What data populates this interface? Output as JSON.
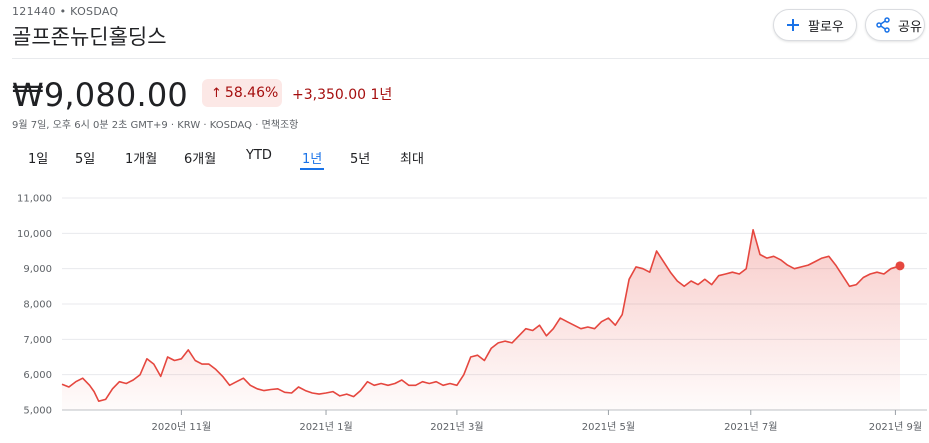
{
  "header": {
    "ticker": "121440 • KOSDAQ",
    "company": "골프존뉴딘홀딩스",
    "follow_label": "팔로우",
    "share_label": "공유"
  },
  "quote": {
    "price": "₩9,080.00",
    "pct_change": "58.46%",
    "abs_change": "+3,350.00 1년",
    "meta": "9월 7일, 오후 6시 0분 2초 GMT+9 · KRW · KOSDAQ · 면책조항"
  },
  "tabs": [
    {
      "label": "1일",
      "active": false
    },
    {
      "label": "5일",
      "active": false
    },
    {
      "label": "1개월",
      "active": false
    },
    {
      "label": "6개월",
      "active": false
    },
    {
      "label": "YTD",
      "active": false
    },
    {
      "label": "1년",
      "active": true
    },
    {
      "label": "5년",
      "active": false
    },
    {
      "label": "최대",
      "active": false
    }
  ],
  "colors": {
    "accent_blue": "#1a73e8",
    "line_red": "#e5473f",
    "loss_gain_red": "#a50e0e",
    "badge_bg": "#fce8e6"
  },
  "chart_data": {
    "type": "area",
    "ylim": [
      5000,
      11000
    ],
    "xlim": [
      0,
      365
    ],
    "y_ticks": [
      {
        "value": 5000,
        "label": "5,000"
      },
      {
        "value": 6000,
        "label": "6,000"
      },
      {
        "value": 7000,
        "label": "7,000"
      },
      {
        "value": 8000,
        "label": "8,000"
      },
      {
        "value": 9000,
        "label": "9,000"
      },
      {
        "value": 10000,
        "label": "10,000"
      },
      {
        "value": 11000,
        "label": "11,000"
      }
    ],
    "x_ticks": [
      {
        "x": 52,
        "label": "2020년 11월"
      },
      {
        "x": 115,
        "label": "2021년 1월"
      },
      {
        "x": 172,
        "label": "2021년 3월"
      },
      {
        "x": 238,
        "label": "2021년 5월"
      },
      {
        "x": 300,
        "label": "2021년 7월"
      },
      {
        "x": 363,
        "label": "2021년 9월"
      }
    ],
    "grid": true,
    "series": [
      {
        "points": [
          [
            0,
            5730
          ],
          [
            3,
            5650
          ],
          [
            6,
            5800
          ],
          [
            9,
            5900
          ],
          [
            12,
            5700
          ],
          [
            14,
            5520
          ],
          [
            16,
            5250
          ],
          [
            19,
            5300
          ],
          [
            22,
            5600
          ],
          [
            25,
            5800
          ],
          [
            28,
            5750
          ],
          [
            31,
            5850
          ],
          [
            34,
            6000
          ],
          [
            37,
            6450
          ],
          [
            40,
            6300
          ],
          [
            43,
            5950
          ],
          [
            46,
            6500
          ],
          [
            49,
            6400
          ],
          [
            52,
            6450
          ],
          [
            55,
            6700
          ],
          [
            58,
            6400
          ],
          [
            61,
            6300
          ],
          [
            64,
            6300
          ],
          [
            67,
            6150
          ],
          [
            70,
            5950
          ],
          [
            73,
            5700
          ],
          [
            76,
            5800
          ],
          [
            79,
            5900
          ],
          [
            82,
            5700
          ],
          [
            85,
            5600
          ],
          [
            88,
            5550
          ],
          [
            91,
            5580
          ],
          [
            94,
            5600
          ],
          [
            97,
            5500
          ],
          [
            100,
            5480
          ],
          [
            103,
            5650
          ],
          [
            106,
            5550
          ],
          [
            109,
            5480
          ],
          [
            112,
            5450
          ],
          [
            115,
            5480
          ],
          [
            118,
            5520
          ],
          [
            121,
            5400
          ],
          [
            124,
            5450
          ],
          [
            127,
            5380
          ],
          [
            130,
            5550
          ],
          [
            133,
            5800
          ],
          [
            136,
            5700
          ],
          [
            139,
            5750
          ],
          [
            142,
            5700
          ],
          [
            145,
            5750
          ],
          [
            148,
            5850
          ],
          [
            151,
            5700
          ],
          [
            154,
            5700
          ],
          [
            157,
            5800
          ],
          [
            160,
            5750
          ],
          [
            163,
            5800
          ],
          [
            166,
            5700
          ],
          [
            169,
            5750
          ],
          [
            172,
            5700
          ],
          [
            175,
            6000
          ],
          [
            178,
            6500
          ],
          [
            181,
            6550
          ],
          [
            184,
            6400
          ],
          [
            187,
            6750
          ],
          [
            190,
            6900
          ],
          [
            193,
            6950
          ],
          [
            196,
            6900
          ],
          [
            199,
            7100
          ],
          [
            202,
            7300
          ],
          [
            205,
            7250
          ],
          [
            208,
            7400
          ],
          [
            211,
            7100
          ],
          [
            214,
            7300
          ],
          [
            217,
            7600
          ],
          [
            220,
            7500
          ],
          [
            223,
            7400
          ],
          [
            226,
            7300
          ],
          [
            229,
            7350
          ],
          [
            232,
            7300
          ],
          [
            235,
            7500
          ],
          [
            238,
            7600
          ],
          [
            241,
            7400
          ],
          [
            244,
            7700
          ],
          [
            247,
            8700
          ],
          [
            250,
            9050
          ],
          [
            253,
            9000
          ],
          [
            256,
            8900
          ],
          [
            259,
            9500
          ],
          [
            262,
            9200
          ],
          [
            265,
            8900
          ],
          [
            268,
            8650
          ],
          [
            271,
            8500
          ],
          [
            274,
            8650
          ],
          [
            277,
            8550
          ],
          [
            280,
            8700
          ],
          [
            283,
            8550
          ],
          [
            286,
            8800
          ],
          [
            289,
            8850
          ],
          [
            292,
            8900
          ],
          [
            295,
            8850
          ],
          [
            298,
            9000
          ],
          [
            301,
            10100
          ],
          [
            304,
            9400
          ],
          [
            307,
            9300
          ],
          [
            310,
            9350
          ],
          [
            313,
            9250
          ],
          [
            316,
            9100
          ],
          [
            319,
            9000
          ],
          [
            322,
            9050
          ],
          [
            325,
            9100
          ],
          [
            328,
            9200
          ],
          [
            331,
            9300
          ],
          [
            334,
            9350
          ],
          [
            337,
            9100
          ],
          [
            340,
            8800
          ],
          [
            343,
            8500
          ],
          [
            346,
            8550
          ],
          [
            349,
            8750
          ],
          [
            352,
            8850
          ],
          [
            355,
            8900
          ],
          [
            358,
            8850
          ],
          [
            361,
            9000
          ],
          [
            365,
            9080
          ]
        ]
      }
    ]
  }
}
